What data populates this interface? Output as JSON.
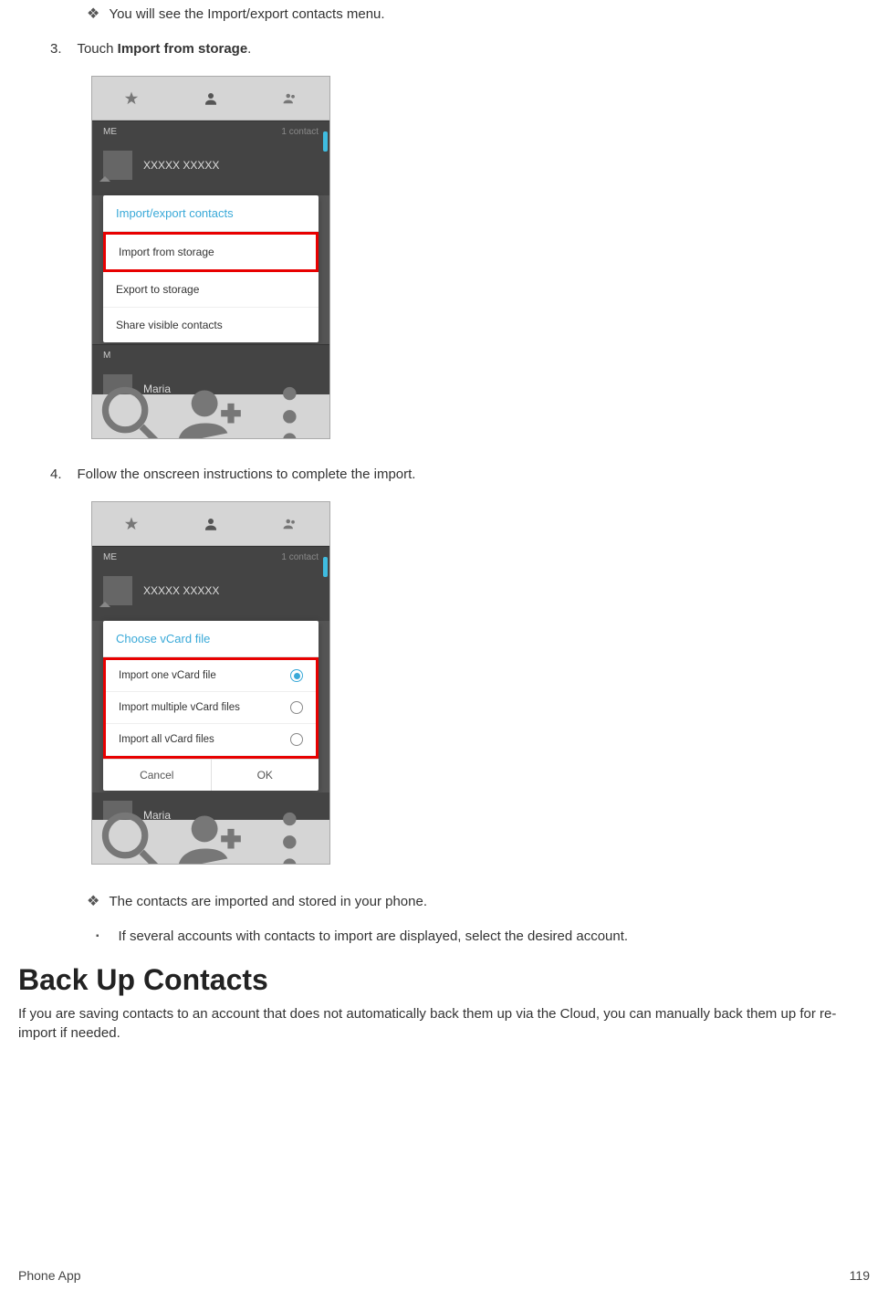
{
  "steps": {
    "note_before_3": "You will see the Import/export contacts menu.",
    "step3_num": "3.",
    "step3_prefix": "Touch ",
    "step3_bold": "Import from storage",
    "step3_suffix": ".",
    "step4_num": "4.",
    "step4_text": "Follow the onscreen instructions to complete the import.",
    "note_after_4": "The contacts are imported and stored in your phone.",
    "sub_note": "If several accounts with contacts to import are displayed, select the desired account."
  },
  "section": {
    "heading": "Back Up Contacts",
    "desc": "If you are saving contacts to an account that does not automatically back them up via the Cloud, you can manually back them up for re-import if needed."
  },
  "footer": {
    "left": "Phone App",
    "right": "119"
  },
  "screenshot1": {
    "section_me": "ME",
    "section_me_right": "1 contact",
    "contact1": "XXXXX XXXXX",
    "popup_title": "Import/export contacts",
    "opt1": "Import from storage",
    "opt2": "Export to storage",
    "opt3": "Share visible contacts",
    "section_m": "M",
    "contact2": "Maria"
  },
  "screenshot2": {
    "section_me": "ME",
    "section_me_right": "1 contact",
    "contact1": "XXXXX XXXXX",
    "popup_title": "Choose vCard file",
    "opt1": "Import one vCard file",
    "opt2": "Import multiple vCard files",
    "opt3": "Import all vCard files",
    "btn_cancel": "Cancel",
    "btn_ok": "OK",
    "contact2": "Maria"
  }
}
